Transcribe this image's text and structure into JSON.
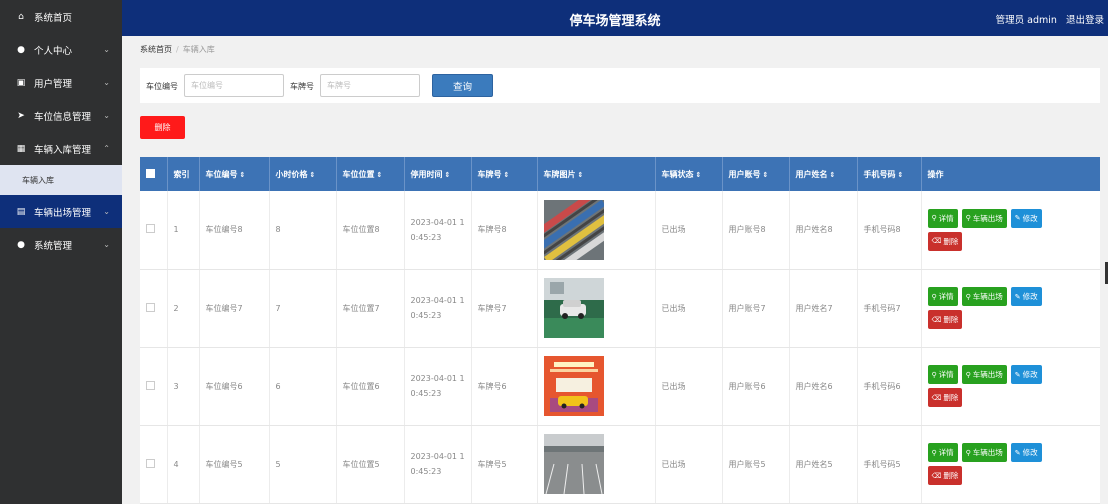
{
  "app": {
    "title": "停车场管理系统"
  },
  "header": {
    "user_role": "管理员 admin",
    "logout": "退出登录"
  },
  "sidebar": {
    "items": [
      {
        "label": "系统首页",
        "icon": "home-icon",
        "glyph": "⌂"
      },
      {
        "label": "个人中心",
        "icon": "user-icon",
        "glyph": "●"
      },
      {
        "label": "用户管理",
        "icon": "users-icon",
        "glyph": "▣"
      },
      {
        "label": "车位信息管理",
        "icon": "send-icon",
        "glyph": "➤"
      },
      {
        "label": "车辆入库管理",
        "icon": "grid-icon",
        "glyph": "▦"
      },
      {
        "label": "车辆出场管理",
        "icon": "clipboard-icon",
        "glyph": "▤"
      },
      {
        "label": "系统管理",
        "icon": "location-icon",
        "glyph": "●"
      }
    ],
    "sub_item": "车辆入库"
  },
  "breadcrumb": {
    "home": "系统首页",
    "current": "车辆入库"
  },
  "search": {
    "field1_label": "车位编号",
    "field1_placeholder": "车位编号",
    "field2_label": "车牌号",
    "field2_placeholder": "车牌号",
    "query_button": "查询"
  },
  "delete_button": "删除",
  "table": {
    "headers": [
      "索引",
      "车位编号",
      "小时价格",
      "车位位置",
      "停用时间",
      "车牌号",
      "车牌图片",
      "车辆状态",
      "用户账号",
      "用户姓名",
      "手机号码",
      "操作"
    ],
    "actions": {
      "detail": "详情",
      "exit": "车辆出场",
      "edit": "修改",
      "delete": "删除"
    },
    "rows": [
      {
        "index": "1",
        "spot": "车位编号8",
        "price": "8",
        "location": "车位位置8",
        "time1": "2023-04-01 1",
        "time2": "0:45:23",
        "plate": "车牌号8",
        "status": "已出场",
        "account": "用户账号8",
        "name": "用户姓名8",
        "phone": "手机号码8"
      },
      {
        "index": "2",
        "spot": "车位编号7",
        "price": "7",
        "location": "车位位置7",
        "time1": "2023-04-01 1",
        "time2": "0:45:23",
        "plate": "车牌号7",
        "status": "已出场",
        "account": "用户账号7",
        "name": "用户姓名7",
        "phone": "手机号码7"
      },
      {
        "index": "3",
        "spot": "车位编号6",
        "price": "6",
        "location": "车位位置6",
        "time1": "2023-04-01 1",
        "time2": "0:45:23",
        "plate": "车牌号6",
        "status": "已出场",
        "account": "用户账号6",
        "name": "用户姓名6",
        "phone": "手机号码6"
      },
      {
        "index": "4",
        "spot": "车位编号5",
        "price": "5",
        "location": "车位位置5",
        "time1": "2023-04-01 1",
        "time2": "0:45:23",
        "plate": "车牌号5",
        "status": "已出场",
        "account": "用户账号5",
        "name": "用户姓名5",
        "phone": "手机号码5"
      }
    ]
  },
  "colors": {
    "sidebar_bg": "#2f3031",
    "header_bg": "#0e2f7a",
    "table_header_bg": "#3d73b5",
    "btn_green": "#28a11f",
    "btn_blue": "#1e90d8",
    "btn_red": "#c9302c",
    "delete_red": "#ff1a1a"
  }
}
